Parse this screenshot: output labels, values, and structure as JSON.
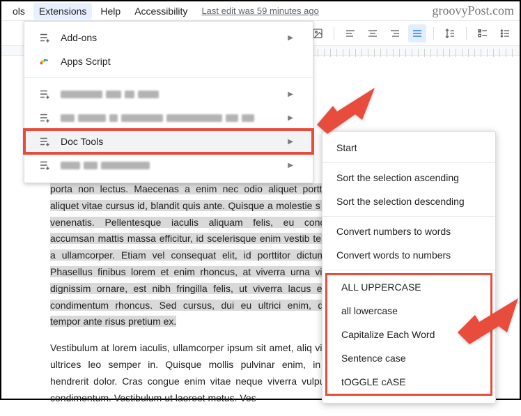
{
  "menubar": {
    "extensions": "Extensions",
    "help": "Help",
    "accessibility": "Accessibility",
    "last_edit": "Last edit was 59 minutes ago",
    "brand": "groovyPost.com"
  },
  "dropdown": {
    "addons": "Add-ons",
    "apps_script": "Apps Script",
    "doc_tools": "Doc Tools"
  },
  "submenu": {
    "start": "Start",
    "sort_asc": "Sort the selection ascending",
    "sort_desc": "Sort the selection descending",
    "num_to_words": "Convert numbers to words",
    "words_to_num": "Convert words to numbers",
    "upper": "ALL UPPERCASE",
    "lower": "all lowercase",
    "cap_each": "Capitalize Each Word",
    "sentence": "Sentence case",
    "toggle": "tOGGLE cASE"
  },
  "doc": {
    "para1": "porta non lectus. Maecenas a enim nec odio aliquet porttitor aliquet vitae cursus id, blandit quis ante. Quisque a molestie s vel venenatis. Pellentesque iaculis aliquam felis, eu condim accumsan mattis massa efficitur, id scelerisque enim vestib tellus a ullamcorper. Etiam vel consequat elit, id porttitor dictumst. Phasellus finibus lorem et enim rhoncus, at viverra urna vitae dignissim ornare, est nibh fringilla felis, ut viverra lacus eget condimentum rhoncus. Sed cursus, dui eu ultrici enim, quis tempor ante risus pretium ex.",
    "para2": "Vestibulum at lorem iaculis, ullamcorper ipsum sit amet, aliq vitae ultrices leo semper in. Quisque mollis pulvinar enim, in m hendrerit dolor. Cras congue enim vitae neque viverra vulputat condimentum. Vestibulum ut laoreet metus. Ves"
  }
}
